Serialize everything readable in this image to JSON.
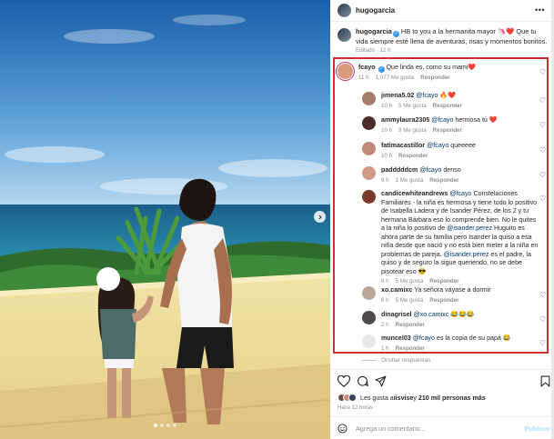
{
  "post": {
    "username": "hugogarcia",
    "more_icon": "more-horizontal-icon",
    "caption": {
      "text": "HB to you a la hermanita mayor 🦄❤️ Que tu vida siempre esté llena de aventuras, risas y momentos bonitos.",
      "time": "Editado · 12 h"
    }
  },
  "highlight_color": "#d32f2f",
  "comments": [
    {
      "user": "fcayo",
      "text": "Que linda es, como su mami❤️",
      "time": "11 h",
      "likes": "1,077 Me gusta",
      "reply": "Responder",
      "avatar": "#d79a7a"
    },
    {
      "user": "jimena5.02",
      "mention": "@fcayo",
      "text": "🔥❤️",
      "time": "10 h",
      "likes": "5 Me gusta",
      "reply": "Responder",
      "avatar": "#a37c6a"
    },
    {
      "user": "ammylaura2305",
      "mention": "@fcayo",
      "text": "hermosa tú ❤️",
      "time": "10 h",
      "likes": "9 Me gusta",
      "reply": "Responder",
      "avatar": "#4b2e2a"
    },
    {
      "user": "fatimacastillor",
      "mention": "@fcayo",
      "text": "queeeee",
      "time": "10 h",
      "likes": "",
      "reply": "Responder",
      "avatar": "#c08a78"
    },
    {
      "user": "padddddcm",
      "mention": "@fcayo",
      "text": "denso",
      "time": "9 h",
      "likes": "1 Me gusta",
      "reply": "Responder",
      "avatar": "#d19a86"
    },
    {
      "user": "candicewhiteandrews",
      "mention": "@fcayo",
      "text_parts": [
        " Constelaciones Familiares - la niña es hermosa y tiene todo lo positivo de Isabella Ladera y de Isander Pérez, de los 2 y tu hermana Bárbara eso lo comprende bien. No le quites a la niña lo positivo de ",
        "@isander.perez",
        " Huguito es ahora parte de su familia pero Isander la quiso a esa niña desde que nació y no está bien meter a la niña en problemas de pareja. ",
        "@isander.perez",
        " es el padre, la quiso y de seguro la sigue queriendo, no se debe pisotear eso 😎"
      ],
      "time": "8 h",
      "likes": "5 Me gusta",
      "reply": "Responder",
      "avatar": "#7a3a2a"
    },
    {
      "user": "xo.camixc",
      "text": "Ya señora váyase a dormir",
      "time": "6 h",
      "likes": "5 Me gusta",
      "reply": "Responder",
      "avatar": "#b8a89a"
    },
    {
      "user": "dinagrisel",
      "mention": "@xo.camixc",
      "text": "😂😂😂",
      "time": "2 h",
      "likes": "",
      "reply": "Responder",
      "avatar": "#4f4a48"
    },
    {
      "user": "muncel03",
      "mention": "@fcayo",
      "text": "es la copia de su papá 😂",
      "time": "1 h",
      "likes": "",
      "reply": "Responder",
      "avatar": "#e8e8e8"
    }
  ],
  "hidden_replies": "Ocultar respuestas",
  "actions": {
    "like_icon": "heart-icon",
    "comment_icon": "comment-icon",
    "share_icon": "send-icon",
    "save_icon": "bookmark-icon"
  },
  "likes": {
    "prefix": "Les gusta a ",
    "user": "iisvise",
    "middle": " y ",
    "count": "210 mil personas más"
  },
  "timestamp": "Hace 12 horas",
  "add_comment": {
    "placeholder": "Agrega un comentario...",
    "post_label": "Publicar"
  }
}
